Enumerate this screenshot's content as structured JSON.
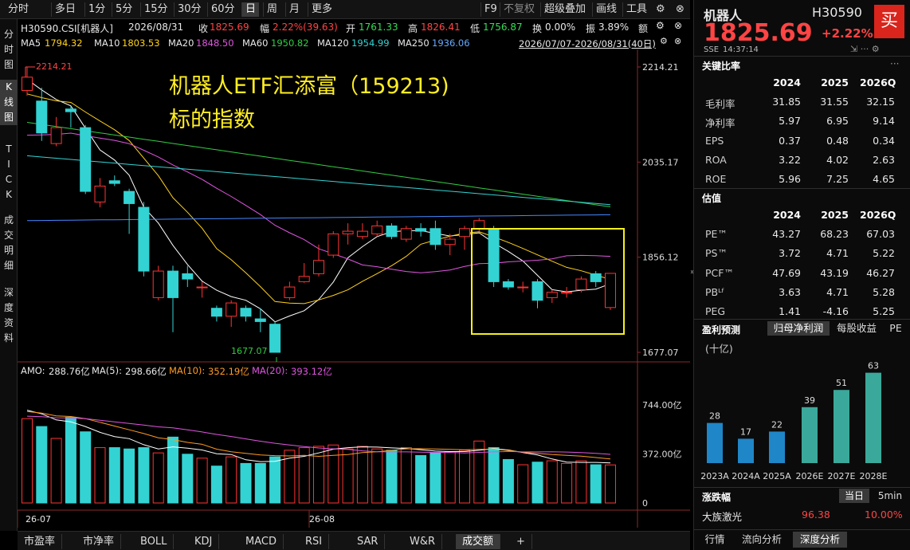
{
  "top_tabs": [
    "分时",
    "多日",
    "1分",
    "5分",
    "15分",
    "30分",
    "60分",
    "日",
    "周",
    "月",
    "更多"
  ],
  "top_tabs_active": "日",
  "top_right_tabs": [
    "F9",
    "不复权",
    "超级叠加",
    "画线",
    "工具"
  ],
  "vertical_tabs": [
    "分时图",
    "K线图",
    "TICK",
    "成交明细",
    "深度资料"
  ],
  "vertical_tabs_active": "K线图",
  "info": {
    "code": "H30590.CSI[机器人]",
    "date": "2026/08/31",
    "close_label": "收",
    "close": "1825.69",
    "change_label": "幅",
    "change": "2.22%(39.63)",
    "open_label": "开",
    "open": "1761.33",
    "high_label": "高",
    "high": "1826.41",
    "low_label": "低",
    "low": "1756.87",
    "hand_label": "换",
    "hand": "0.00%",
    "amp_label": "振",
    "amp": "3.89%",
    "vol_label": "额"
  },
  "ma": {
    "ma5_label": "MA5",
    "ma5": "1794.32",
    "ma10_label": "MA10",
    "ma10": "1803.53",
    "ma20_label": "MA20",
    "ma20": "1848.50",
    "ma60_label": "MA60",
    "ma60": "1950.82",
    "ma120_label": "MA120",
    "ma120": "1954.99",
    "ma250_label": "MA250",
    "ma250": "1936.06",
    "range": "2026/07/07-2026/08/31(40日)"
  },
  "annotation": {
    "line1": "机器人ETF汇添富（159213)",
    "line2": "标的指数"
  },
  "price_axis": [
    "2214.21",
    "2035.17",
    "1856.12",
    "1677.07"
  ],
  "max_label": "2214.21",
  "min_label": "1677.07",
  "volume": {
    "amo_label": "AMO:",
    "amo": "288.76亿",
    "ma5_label": "MA(5):",
    "ma5": "298.66亿",
    "ma10_label": "MA(10):",
    "ma10": "352.19亿",
    "ma20_label": "MA(20):",
    "ma20": "393.12亿",
    "axis": [
      "744.00亿",
      "372.00亿",
      "0"
    ]
  },
  "date_axis": [
    "26-07",
    "26-08"
  ],
  "bottom_tabs": [
    "市盈率",
    "市净率",
    "BOLL",
    "KDJ",
    "MACD",
    "RSI",
    "SAR",
    "W&R",
    "成交额",
    "+"
  ],
  "bottom_tabs_active": "成交额",
  "colors": {
    "up": "#ff3333",
    "down": "#33d3d3",
    "ma5": "#ffffff",
    "ma10": "#ffd21a",
    "ma20": "#e055e0",
    "ma60": "#33cc44",
    "ma120": "#33d3d3",
    "ma250": "#4488ff",
    "highlight": "#f5f01c"
  },
  "chart_data": {
    "type": "candlestick",
    "dates_start": "2026/07/07",
    "dates_end": "2026/08/31",
    "candles": [
      {
        "o": 2170,
        "c": 2195,
        "h": 2214.21,
        "l": 2160
      },
      {
        "o": 2150,
        "c": 2090,
        "h": 2175,
        "l": 2075
      },
      {
        "o": 2070,
        "c": 2100,
        "h": 2120,
        "l": 2065
      },
      {
        "o": 2135,
        "c": 2130,
        "h": 2140,
        "l": 2100
      },
      {
        "o": 2100,
        "c": 1980,
        "h": 2105,
        "l": 1975
      },
      {
        "o": 1960,
        "c": 1990,
        "h": 2005,
        "l": 1950
      },
      {
        "o": 2000,
        "c": 1995,
        "h": 2010,
        "l": 1990
      },
      {
        "o": 1980,
        "c": 1957,
        "h": 1985,
        "l": 1900
      },
      {
        "o": 1950,
        "c": 1830,
        "h": 1960,
        "l": 1820
      },
      {
        "o": 1780,
        "c": 1830,
        "h": 1840,
        "l": 1775
      },
      {
        "o": 1830,
        "c": 1780,
        "h": 1840,
        "l": 1715
      },
      {
        "o": 1825,
        "c": 1815,
        "h": 1840,
        "l": 1800
      },
      {
        "o": 1800,
        "c": 1800,
        "h": 1810,
        "l": 1780
      },
      {
        "o": 1760,
        "c": 1745,
        "h": 1765,
        "l": 1735
      },
      {
        "o": 1745,
        "c": 1770,
        "h": 1775,
        "l": 1725
      },
      {
        "o": 1760,
        "c": 1745,
        "h": 1765,
        "l": 1735
      },
      {
        "o": 1740,
        "c": 1735,
        "h": 1760,
        "l": 1715
      },
      {
        "o": 1730,
        "c": 1677.07,
        "h": 1735,
        "l": 1677.07
      },
      {
        "o": 1780,
        "c": 1800,
        "h": 1810,
        "l": 1775
      },
      {
        "o": 1810,
        "c": 1820,
        "h": 1845,
        "l": 1808
      },
      {
        "o": 1825,
        "c": 1850,
        "h": 1880,
        "l": 1820
      },
      {
        "o": 1860,
        "c": 1900,
        "h": 1905,
        "l": 1855
      },
      {
        "o": 1900,
        "c": 1905,
        "h": 1920,
        "l": 1880
      },
      {
        "o": 1895,
        "c": 1905,
        "h": 1920,
        "l": 1890
      },
      {
        "o": 1900,
        "c": 1915,
        "h": 1925,
        "l": 1895
      },
      {
        "o": 1915,
        "c": 1895,
        "h": 1920,
        "l": 1890
      },
      {
        "o": 1890,
        "c": 1910,
        "h": 1915,
        "l": 1885
      },
      {
        "o": 1910,
        "c": 1905,
        "h": 1920,
        "l": 1895
      },
      {
        "o": 1910,
        "c": 1880,
        "h": 1925,
        "l": 1870
      },
      {
        "o": 1880,
        "c": 1890,
        "h": 1900,
        "l": 1860
      },
      {
        "o": 1895,
        "c": 1910,
        "h": 1915,
        "l": 1870
      },
      {
        "o": 1910,
        "c": 1925,
        "h": 1930,
        "l": 1905
      },
      {
        "o": 1910,
        "c": 1810,
        "h": 1915,
        "l": 1800
      },
      {
        "o": 1810,
        "c": 1800,
        "h": 1815,
        "l": 1795
      },
      {
        "o": 1800,
        "c": 1800,
        "h": 1810,
        "l": 1790
      },
      {
        "o": 1810,
        "c": 1775,
        "h": 1815,
        "l": 1760
      },
      {
        "o": 1780,
        "c": 1790,
        "h": 1795,
        "l": 1770
      },
      {
        "o": 1790,
        "c": 1790,
        "h": 1800,
        "l": 1780
      },
      {
        "o": 1795,
        "c": 1815,
        "h": 1820,
        "l": 1790
      },
      {
        "o": 1825,
        "c": 1810,
        "h": 1830,
        "l": 1800
      },
      {
        "o": 1761.33,
        "c": 1825.69,
        "h": 1826.41,
        "l": 1756.87
      }
    ],
    "price_range": [
      1677.07,
      2214.21
    ],
    "volume": [
      640,
      580,
      490,
      650,
      540,
      420,
      420,
      410,
      420,
      380,
      500,
      370,
      340,
      280,
      350,
      300,
      300,
      350,
      400,
      420,
      430,
      440,
      410,
      430,
      410,
      400,
      420,
      360,
      380,
      390,
      400,
      470,
      420,
      330,
      290,
      310,
      320,
      300,
      320,
      290,
      288.76
    ],
    "volume_range": [
      0,
      744
    ]
  },
  "right": {
    "name": "机器人",
    "code": "H30590",
    "price": "1825.69",
    "change": "+2.22%",
    "buy": "买",
    "exchange": "SSE",
    "time": "14:37:14",
    "ratios_title": "关键比率",
    "years": [
      "2024",
      "2025",
      "2026Q"
    ],
    "ratios": [
      {
        "label": "毛利率",
        "v": [
          "31.85",
          "31.55",
          "32.15"
        ]
      },
      {
        "label": "净利率",
        "v": [
          "5.97",
          "6.95",
          "9.14"
        ]
      },
      {
        "label": "EPS",
        "v": [
          "0.37",
          "0.48",
          "0.34"
        ]
      },
      {
        "label": "ROA",
        "v": [
          "3.22",
          "4.02",
          "2.63"
        ]
      },
      {
        "label": "ROE",
        "v": [
          "5.96",
          "7.25",
          "4.65"
        ]
      }
    ],
    "valuation_title": "估值",
    "val_years": [
      "2024",
      "2025",
      "2026Q"
    ],
    "valuation": [
      {
        "label": "PE™",
        "v": [
          "43.27",
          "68.23",
          "67.03"
        ]
      },
      {
        "label": "PS™",
        "v": [
          "3.72",
          "4.71",
          "5.22"
        ]
      },
      {
        "label": "PCF™",
        "v": [
          "47.69",
          "43.19",
          "46.27"
        ]
      },
      {
        "label": "PBᴸᶠ",
        "v": [
          "3.63",
          "4.71",
          "5.28"
        ]
      },
      {
        "label": "PEG",
        "v": [
          "1.41",
          "-4.16",
          "5.25"
        ]
      }
    ],
    "forecast_title": "盈利预测",
    "forecast_tabs": [
      "归母净利润",
      "每股收益",
      "PE"
    ],
    "forecast_unit": "(十亿)",
    "forecast": {
      "categories": [
        "2023A",
        "2024A",
        "2025A",
        "2026E",
        "2027E",
        "2028E"
      ],
      "values": [
        28,
        17,
        22,
        39,
        51,
        63
      ]
    },
    "movers_title": "涨跌幅",
    "movers_tabs": [
      "当日",
      "5min"
    ],
    "movers": [
      {
        "name": "大族激光",
        "price": "96.38",
        "pct": "10.00%"
      }
    ],
    "bottom_tabs": [
      "行情",
      "流向分析",
      "深度分析"
    ],
    "bottom_tabs_active": "深度分析"
  }
}
